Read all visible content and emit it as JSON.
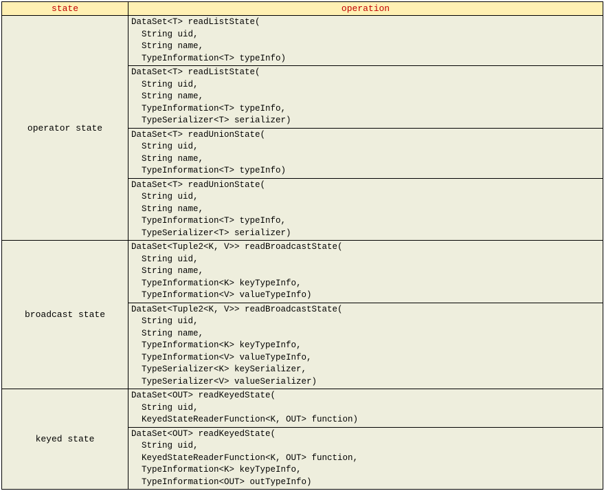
{
  "headers": {
    "state": "state",
    "operation": "operation"
  },
  "groups": [
    {
      "state": "operator state",
      "operations": [
        "DataSet<T> readListState(\n  String uid,\n  String name,\n  TypeInformation<T> typeInfo)",
        "DataSet<T> readListState(\n  String uid,\n  String name,\n  TypeInformation<T> typeInfo,\n  TypeSerializer<T> serializer)",
        "DataSet<T> readUnionState(\n  String uid,\n  String name,\n  TypeInformation<T> typeInfo)",
        "DataSet<T> readUnionState(\n  String uid,\n  String name,\n  TypeInformation<T> typeInfo,\n  TypeSerializer<T> serializer)"
      ]
    },
    {
      "state": "broadcast state",
      "operations": [
        "DataSet<Tuple2<K, V>> readBroadcastState(\n  String uid,\n  String name,\n  TypeInformation<K> keyTypeInfo,\n  TypeInformation<V> valueTypeInfo)",
        "DataSet<Tuple2<K, V>> readBroadcastState(\n  String uid,\n  String name,\n  TypeInformation<K> keyTypeInfo,\n  TypeInformation<V> valueTypeInfo,\n  TypeSerializer<K> keySerializer,\n  TypeSerializer<V> valueSerializer)"
      ]
    },
    {
      "state": "keyed state",
      "operations": [
        "DataSet<OUT> readKeyedState(\n  String uid,\n  KeyedStateReaderFunction<K, OUT> function)",
        "DataSet<OUT> readKeyedState(\n  String uid,\n  KeyedStateReaderFunction<K, OUT> function,\n  TypeInformation<K> keyTypeInfo,\n  TypeInformation<OUT> outTypeInfo)"
      ]
    }
  ]
}
